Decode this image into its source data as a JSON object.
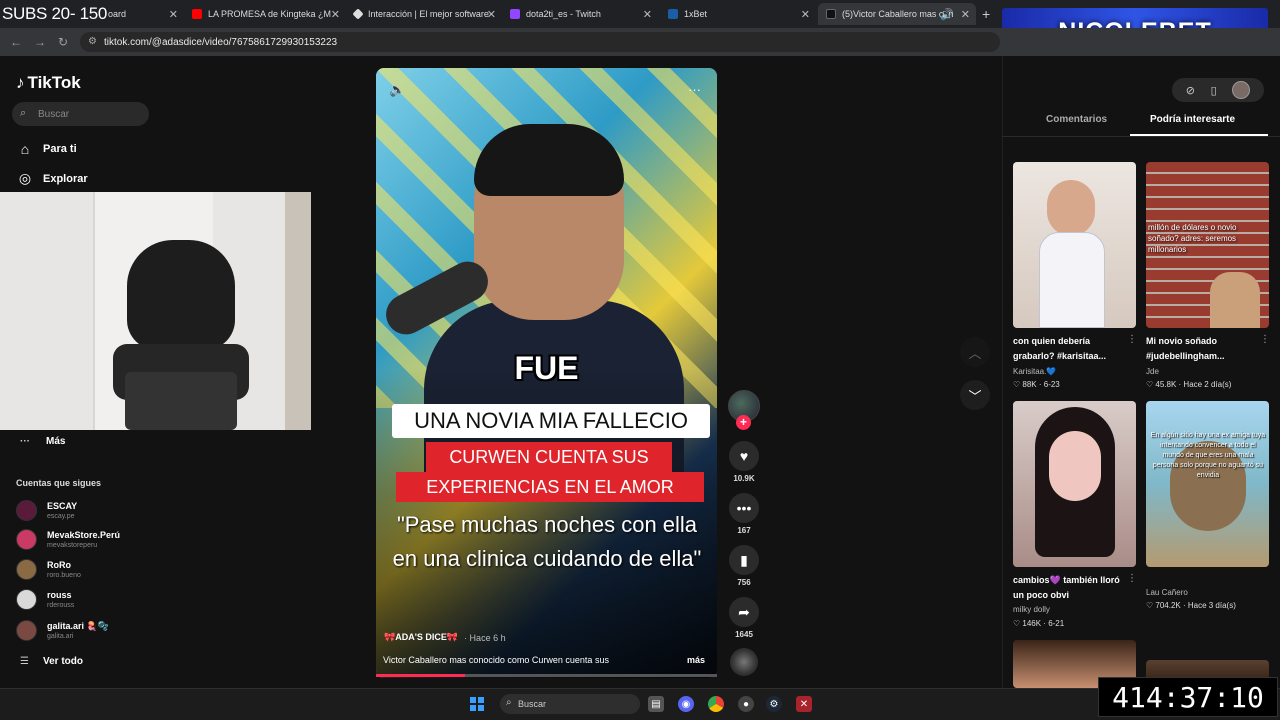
{
  "overlay": {
    "subs_counter": "SUBS 20- 150",
    "banner": "NICOLEBET",
    "stream_timer": "414:37:10"
  },
  "browser": {
    "tabs": [
      {
        "label": "oard",
        "color": "#444444"
      },
      {
        "label": "LA PROMESA de Kingteka ¿M",
        "color": "#ff0000"
      },
      {
        "label": "Interacción | El mejor software",
        "color": "#dddddd"
      },
      {
        "label": "dota2ti_es - Twitch",
        "color": "#9146ff"
      },
      {
        "label": "1xBet",
        "color": "#1a5ea8"
      },
      {
        "label": "(5)Victor Caballero mas con",
        "color": "#111111"
      }
    ],
    "url": "tiktok.com/@adasdice/video/7675861729930153223"
  },
  "sidebar": {
    "logo": "TikTok",
    "search_placeholder": "Buscar",
    "nav": [
      {
        "label": "Para ti",
        "icon": "home-icon"
      },
      {
        "label": "Explorar",
        "icon": "compass-icon"
      }
    ],
    "more_label": "Más",
    "following_title": "Cuentas que sigues",
    "accounts": [
      {
        "name": "ESCAY",
        "handle": "escay.pe",
        "color": "#5a1a3a"
      },
      {
        "name": "MevakStore.Perú",
        "handle": "mevakstoreperu",
        "color": "#c93a64"
      },
      {
        "name": "RoRo",
        "handle": "roro.bueno",
        "color": "#8a6a44"
      },
      {
        "name": "rouss",
        "handle": "rderouss",
        "color": "#d9d9d9"
      },
      {
        "name": "galita.ari 🪼🫧",
        "handle": "galita.ari",
        "color": "#7a4a42"
      }
    ],
    "see_all": "Ver todo"
  },
  "video": {
    "caption_fue": "FUE",
    "caption_white": "UNA NOVIA MIA FALLECIO",
    "caption_red1": "CURWEN CUENTA SUS",
    "caption_red2": "EXPERIENCIAS EN EL AMOR",
    "caption_quote": "\"Pase muchas noches con ella en una clinica cuidando de ella\"",
    "author": "🎀ADA'S DICE🎀",
    "time": "· Hace 6 h",
    "description": "Victor Caballero mas conocido como Curwen cuenta sus",
    "more": "más",
    "progress_percent": 26,
    "actions": {
      "likes": "10.9K",
      "comments": "167",
      "saves": "756",
      "shares": "1645"
    }
  },
  "right_panel": {
    "tabs": [
      "Comentarios",
      "Podría interesarte"
    ],
    "active_tab": "Podría interesarte",
    "thumbs": [
      {
        "title": "con quien debería grabarlo? #karisitaa...",
        "user": "Karisitaa.💙",
        "stats": "♡ 88K · 6-23",
        "bg": "linear-gradient(180deg,#e9e2dc,#cfc4bb)"
      },
      {
        "title": "Mi novio soñado #judebellingham...",
        "user": "Jde",
        "stats": "♡ 45.8K · Hace 2 día(s)",
        "bg": "repeating-linear-gradient(0deg,#9a3b30 0 10px,#c8c0b8 10px 12px)"
      },
      {
        "title": "cambios💜 también lloró un poco obvi",
        "user": "milky dolly",
        "stats": "♡ 146K · 6-21",
        "bg": "linear-gradient(180deg,#d8c8c4,#a88a86)"
      },
      {
        "title": "",
        "user": "Lau Cañero",
        "stats": "♡ 704.2K · Hace 3 día(s)",
        "bg": "linear-gradient(180deg,#a8d6ef,#7fb8c8 50%,#b49a70)"
      }
    ],
    "thumb_texts": {
      "t2_overlay": "millón de dólares o novio soñado? adres: seremos millonarios",
      "t4_overlay": "En algún sitio hay una ex amiga tuya intentando convencer a todo el mundo de que eres una mala persona solo porque no aguantó su envidia"
    }
  },
  "taskbar": {
    "search_placeholder": "Buscar"
  }
}
